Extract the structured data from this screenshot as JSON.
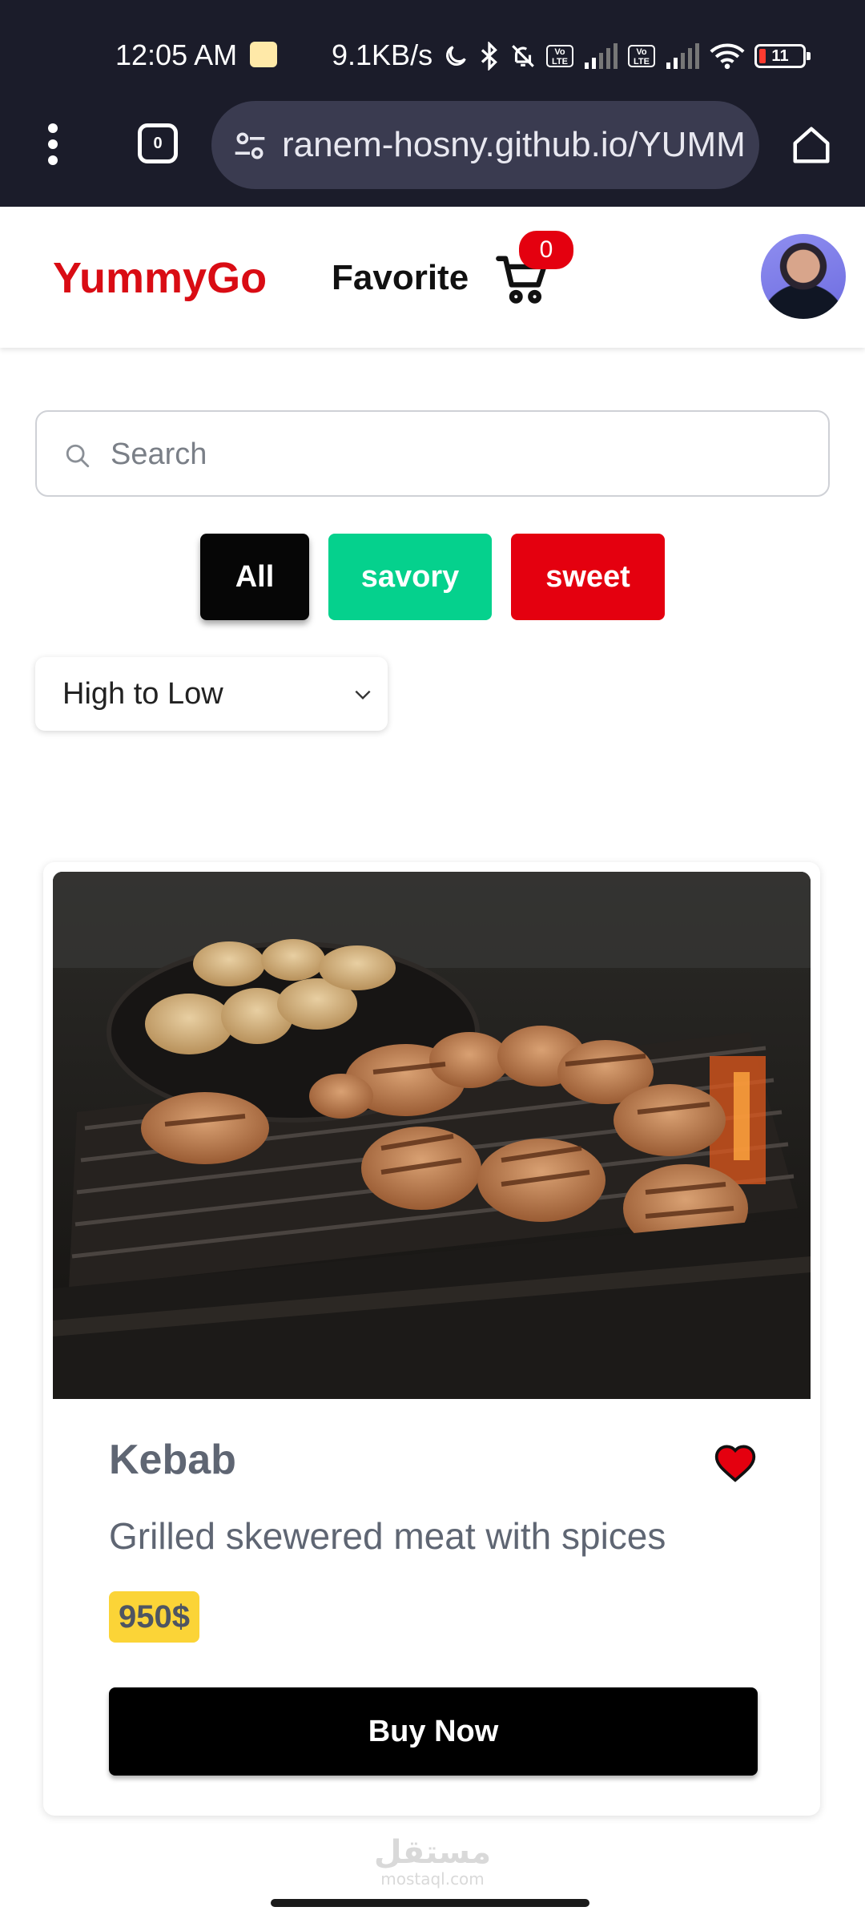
{
  "status_bar": {
    "time": "12:05 AM",
    "network_speed": "9.1KB/s",
    "volte_label": "Vo LTE",
    "battery_level": "11"
  },
  "browser": {
    "tab_count": "0",
    "url": "ranem-hosny.github.io/YUMMYGO/"
  },
  "header": {
    "brand": "YummyGo",
    "nav_favorite": "Favorite",
    "cart_count": "0"
  },
  "search": {
    "placeholder": "Search",
    "value": ""
  },
  "filters": {
    "all": "All",
    "savory": "savory",
    "sweet": "sweet"
  },
  "sort": {
    "selected": "High to Low"
  },
  "product": {
    "title": "Kebab",
    "description": "Grilled skewered meat with spices",
    "price": "950$",
    "buy_label": "Buy Now"
  },
  "watermark": {
    "arabic": "مستقل",
    "latin": "mostaql.com"
  },
  "colors": {
    "brand_red": "#d90c14",
    "savory_green": "#05d18d",
    "sweet_red": "#e4000f",
    "price_yellow": "#fbd437",
    "chrome_dark": "#1b1c2a"
  },
  "icons": [
    "moon-icon",
    "bluetooth-icon",
    "bell-off-icon",
    "signal-icon",
    "wifi-icon",
    "battery-icon",
    "more-vert-icon",
    "tabs-icon",
    "site-settings-icon",
    "home-icon",
    "cart-icon",
    "search-icon",
    "chevron-down-icon",
    "heart-icon"
  ]
}
